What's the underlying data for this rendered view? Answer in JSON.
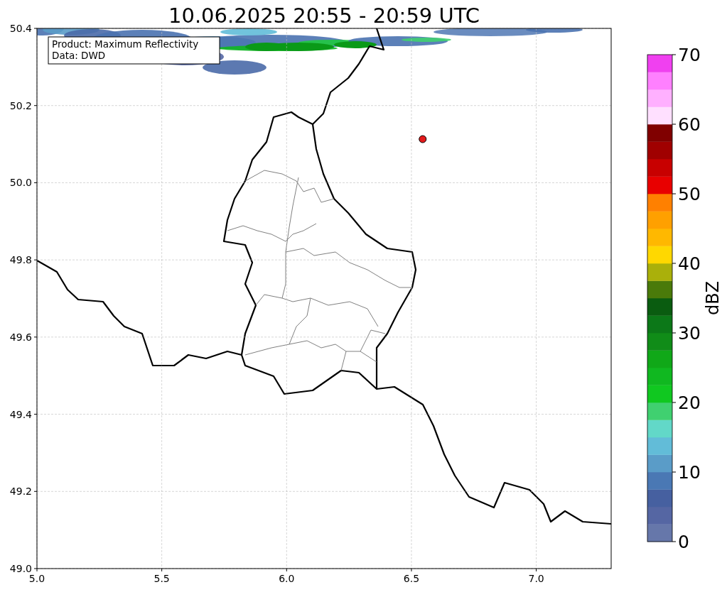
{
  "chart_data": {
    "type": "scatter",
    "title": "10.06.2025 20:55 - 20:59 UTC",
    "grid": true,
    "xlim": [
      5.0,
      7.3
    ],
    "ylim": [
      49.0,
      50.4
    ],
    "xticks": [
      {
        "value": 5.0,
        "label": "5.0"
      },
      {
        "value": 5.5,
        "label": "5.5"
      },
      {
        "value": 6.0,
        "label": "6.0"
      },
      {
        "value": 6.5,
        "label": "6.5"
      },
      {
        "value": 7.0,
        "label": "7.0"
      }
    ],
    "yticks": [
      {
        "value": 49.0,
        "label": "49.0"
      },
      {
        "value": 49.2,
        "label": "49.2"
      },
      {
        "value": 49.4,
        "label": "49.4"
      },
      {
        "value": 49.6,
        "label": "49.6"
      },
      {
        "value": 49.8,
        "label": "49.8"
      },
      {
        "value": 50.0,
        "label": "50.0"
      },
      {
        "value": 50.2,
        "label": "50.2"
      },
      {
        "value": 50.4,
        "label": "50.4"
      }
    ],
    "x": [
      6.545
    ],
    "series": [
      {
        "color": "#e31a1c",
        "values": [
          50.113
        ]
      }
    ],
    "annotations": [
      "Product: Maximum Reflectivity",
      "Data: DWD"
    ]
  },
  "colorbar": {
    "label": "dBZ",
    "ticks": [
      "70",
      "60",
      "50",
      "40",
      "30",
      "20",
      "10",
      "0"
    ],
    "segments": [
      {
        "color": "#6677aa"
      },
      {
        "color": "#5566a3"
      },
      {
        "color": "#4660a0"
      },
      {
        "color": "#4a78b4"
      },
      {
        "color": "#5a9cc8"
      },
      {
        "color": "#62bcd8"
      },
      {
        "color": "#62d8c8"
      },
      {
        "color": "#40d070"
      },
      {
        "color": "#10c820"
      },
      {
        "color": "#10b820"
      },
      {
        "color": "#10a818"
      },
      {
        "color": "#108c18"
      },
      {
        "color": "#0c7818"
      },
      {
        "color": "#0a5c10"
      },
      {
        "color": "#4a7a0a"
      },
      {
        "color": "#aab00a"
      },
      {
        "color": "#ffd800"
      },
      {
        "color": "#ffb800"
      },
      {
        "color": "#ffa000"
      },
      {
        "color": "#ff8000"
      },
      {
        "color": "#e80000"
      },
      {
        "color": "#c80000"
      },
      {
        "color": "#a00000"
      },
      {
        "color": "#800000"
      },
      {
        "color": "#ffe0ff"
      },
      {
        "color": "#ffb0ff"
      },
      {
        "color": "#ff80ff"
      },
      {
        "color": "#f040f0"
      }
    ]
  }
}
